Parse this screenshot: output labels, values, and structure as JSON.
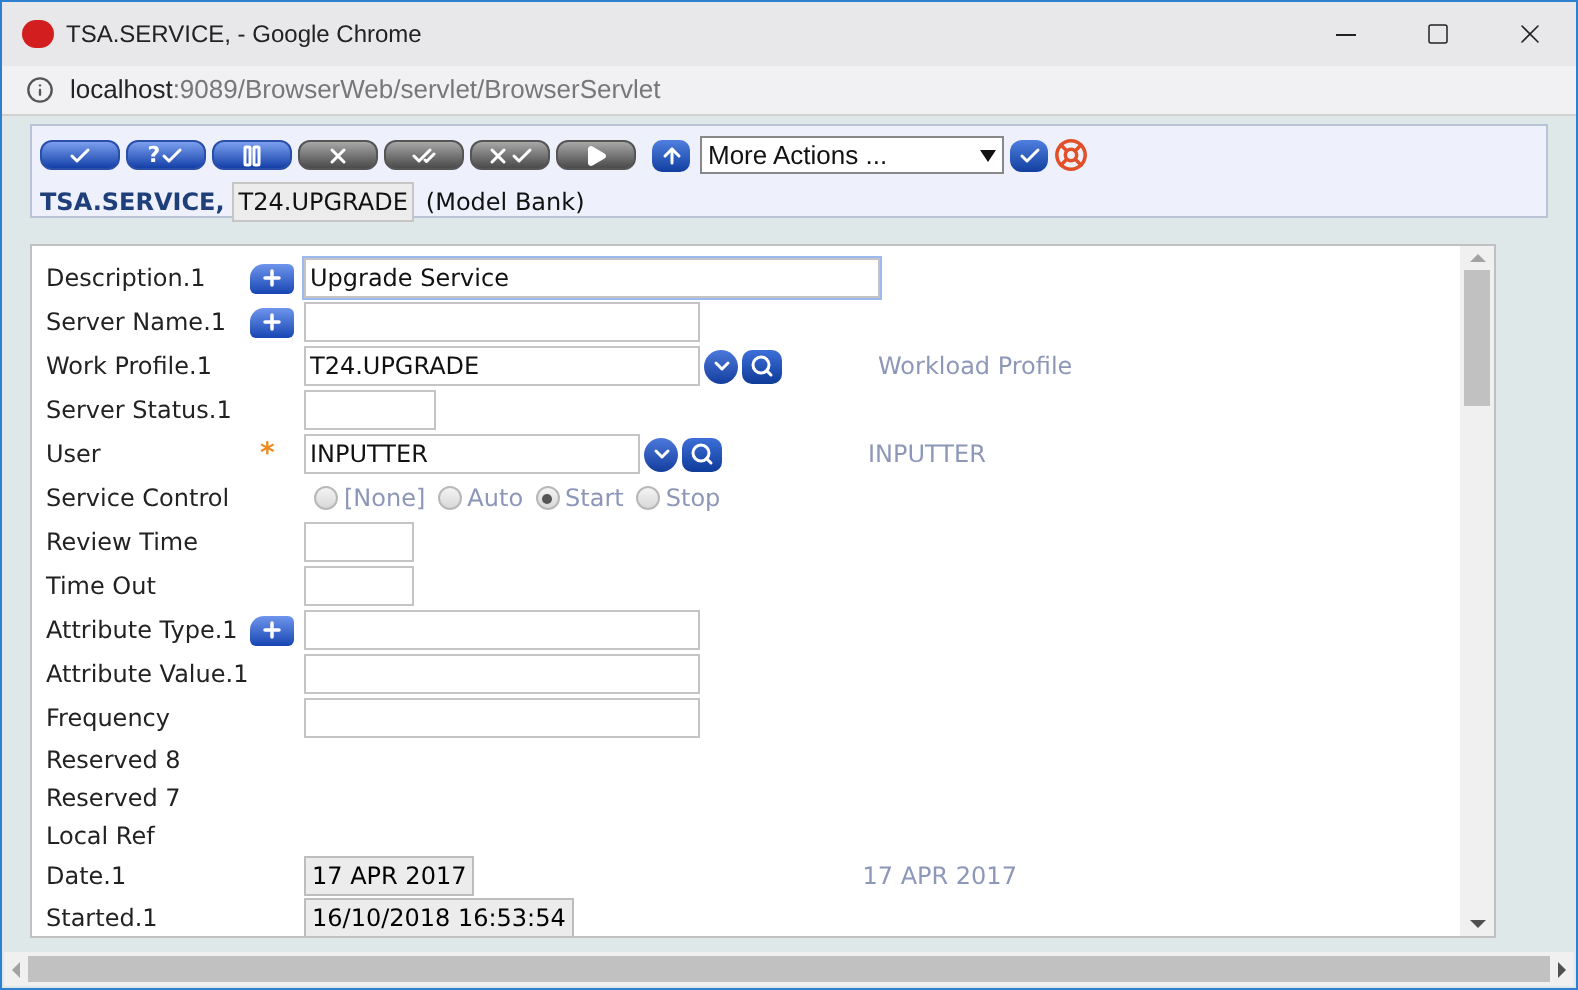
{
  "window": {
    "title": "TSA.SERVICE, - Google Chrome"
  },
  "address_bar": {
    "host": "localhost",
    "path": ":9089/BrowserWeb/servlet/BrowserServlet"
  },
  "toolbar": {
    "buttons": [
      {
        "kind": "check",
        "enabled": true
      },
      {
        "kind": "question-check",
        "enabled": true,
        "label": "?"
      },
      {
        "kind": "pause",
        "enabled": true
      },
      {
        "kind": "cross",
        "enabled": false
      },
      {
        "kind": "double-check",
        "enabled": false
      },
      {
        "kind": "cross-check",
        "enabled": false
      },
      {
        "kind": "play",
        "enabled": false
      }
    ],
    "actions_select": "More Actions ..."
  },
  "header": {
    "application": "TSA.SERVICE,",
    "record_id": "T24.UPGRADE",
    "company": "(Model Bank)"
  },
  "fields": [
    {
      "label": "Description.1",
      "kind": "text",
      "expand": true,
      "value": "Upgrade Service",
      "focused": true
    },
    {
      "label": "Server Name.1",
      "kind": "text",
      "expand": true
    },
    {
      "label": "Work Profile.1",
      "kind": "text",
      "expand": false,
      "value": "T24.UPGRADE",
      "lookup": true,
      "enrichment": "Workload Profile"
    },
    {
      "label": "Server Status.1",
      "kind": "medium",
      "expand": false
    },
    {
      "label": "User",
      "kind": "text",
      "expand": false,
      "required_marker": "*",
      "value": "INPUTTER",
      "lookup": true,
      "enrichment": "INPUTTER"
    },
    {
      "label": "Service Control",
      "kind": "radio",
      "expand": false,
      "options": [
        {
          "label": "[None]",
          "selected": false
        },
        {
          "label": "Auto",
          "selected": false
        },
        {
          "label": "Start",
          "selected": true
        },
        {
          "label": "Stop",
          "selected": false
        }
      ]
    },
    {
      "label": "Review Time",
      "kind": "short",
      "expand": false
    },
    {
      "label": "Time Out",
      "kind": "short",
      "expand": false
    },
    {
      "label": "Attribute Type.1",
      "kind": "text",
      "expand": true
    },
    {
      "label": "Attribute Value.1",
      "kind": "text",
      "expand": false
    },
    {
      "label": "Frequency",
      "kind": "text",
      "expand": false
    },
    {
      "label": "Reserved 8",
      "kind": "plain",
      "expand": false
    },
    {
      "label": "Reserved 7",
      "kind": "plain",
      "expand": false
    },
    {
      "label": "Local Ref",
      "kind": "plain",
      "expand": false
    },
    {
      "label": "Date.1",
      "kind": "readonly",
      "expand": false,
      "value": "17 APR 2017",
      "enrichment": "17 APR 2017"
    },
    {
      "label": "Started.1",
      "kind": "readonly",
      "expand": false,
      "value": "16/10/2018 16:53:54"
    }
  ]
}
